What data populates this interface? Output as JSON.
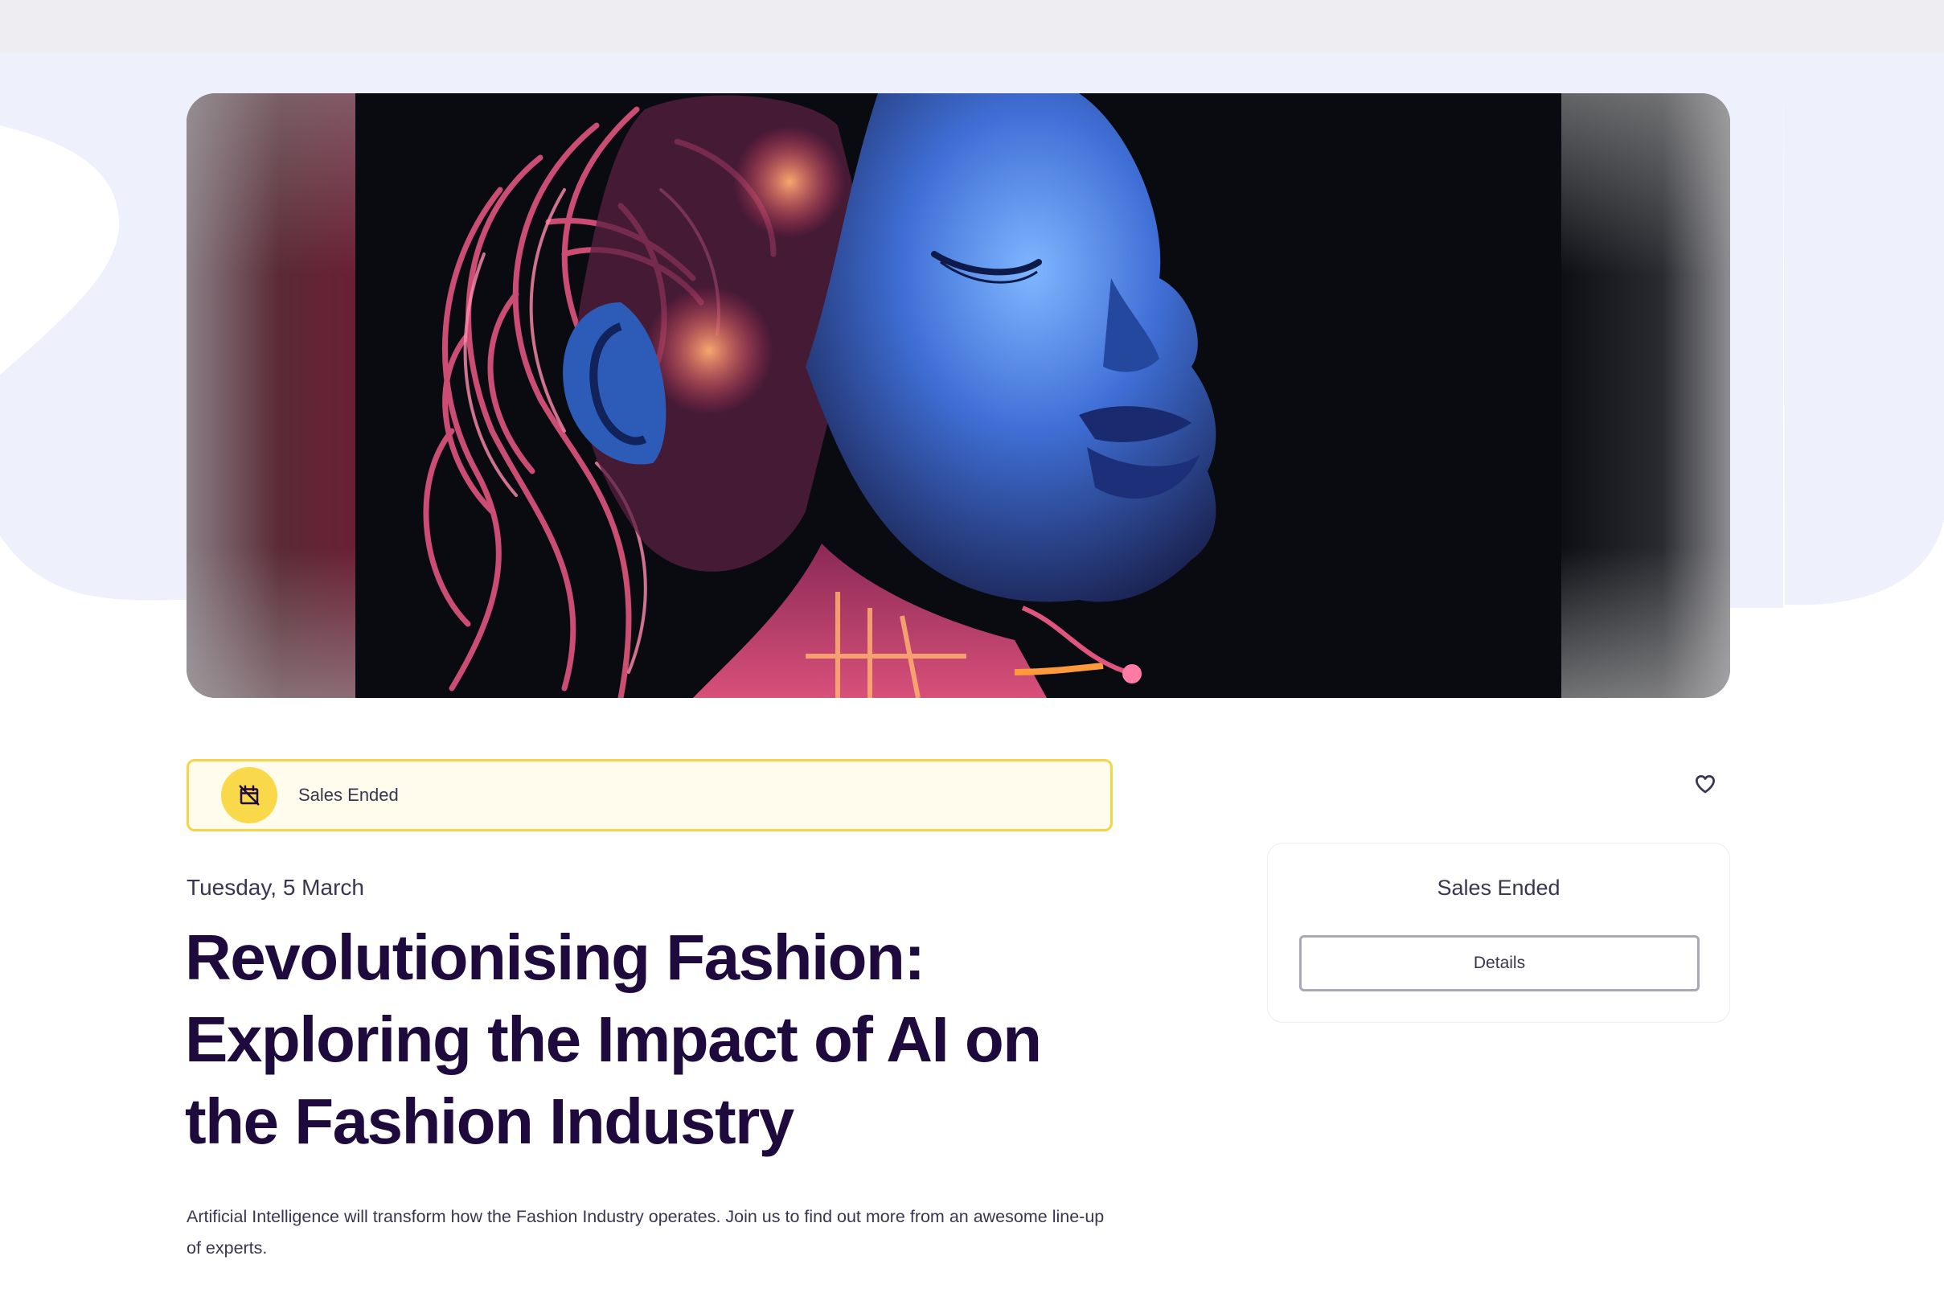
{
  "status_banner": {
    "icon": "calendar-off-icon",
    "text": "Sales Ended",
    "border_color": "#f5d547",
    "background_color": "#fffbed",
    "icon_circle_color": "#f9d94a"
  },
  "like_button": {
    "icon": "heart-outline-icon"
  },
  "event": {
    "date": "Tuesday, 5 March",
    "title": "Revolutionising Fashion: Exploring the Impact of AI on the Fashion Industry",
    "summary": "Artificial Intelligence will transform how the Fashion Industry operates. Join us to find out more from an awesome line-up of experts."
  },
  "ticket_card": {
    "status": "Sales Ended",
    "details_label": "Details"
  },
  "colors": {
    "title": "#1e0a3c",
    "body_text": "#39364f",
    "backdrop": "#eef0fb",
    "top_strip": "#eeedf2"
  }
}
